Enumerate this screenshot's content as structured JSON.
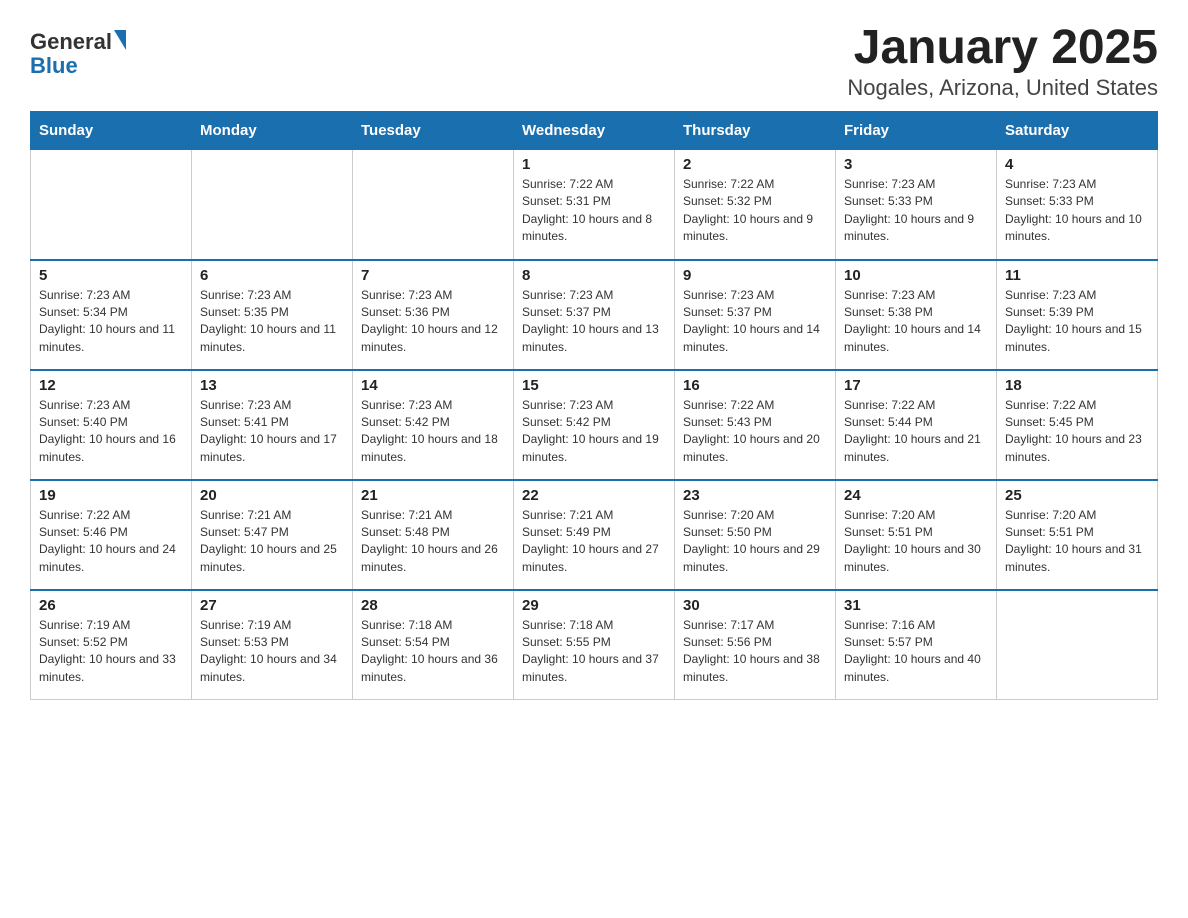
{
  "header": {
    "logo_general": "General",
    "logo_blue": "Blue",
    "month_title": "January 2025",
    "location": "Nogales, Arizona, United States"
  },
  "days_of_week": [
    "Sunday",
    "Monday",
    "Tuesday",
    "Wednesday",
    "Thursday",
    "Friday",
    "Saturday"
  ],
  "weeks": [
    [
      {
        "day": "",
        "info": ""
      },
      {
        "day": "",
        "info": ""
      },
      {
        "day": "",
        "info": ""
      },
      {
        "day": "1",
        "info": "Sunrise: 7:22 AM\nSunset: 5:31 PM\nDaylight: 10 hours and 8 minutes."
      },
      {
        "day": "2",
        "info": "Sunrise: 7:22 AM\nSunset: 5:32 PM\nDaylight: 10 hours and 9 minutes."
      },
      {
        "day": "3",
        "info": "Sunrise: 7:23 AM\nSunset: 5:33 PM\nDaylight: 10 hours and 9 minutes."
      },
      {
        "day": "4",
        "info": "Sunrise: 7:23 AM\nSunset: 5:33 PM\nDaylight: 10 hours and 10 minutes."
      }
    ],
    [
      {
        "day": "5",
        "info": "Sunrise: 7:23 AM\nSunset: 5:34 PM\nDaylight: 10 hours and 11 minutes."
      },
      {
        "day": "6",
        "info": "Sunrise: 7:23 AM\nSunset: 5:35 PM\nDaylight: 10 hours and 11 minutes."
      },
      {
        "day": "7",
        "info": "Sunrise: 7:23 AM\nSunset: 5:36 PM\nDaylight: 10 hours and 12 minutes."
      },
      {
        "day": "8",
        "info": "Sunrise: 7:23 AM\nSunset: 5:37 PM\nDaylight: 10 hours and 13 minutes."
      },
      {
        "day": "9",
        "info": "Sunrise: 7:23 AM\nSunset: 5:37 PM\nDaylight: 10 hours and 14 minutes."
      },
      {
        "day": "10",
        "info": "Sunrise: 7:23 AM\nSunset: 5:38 PM\nDaylight: 10 hours and 14 minutes."
      },
      {
        "day": "11",
        "info": "Sunrise: 7:23 AM\nSunset: 5:39 PM\nDaylight: 10 hours and 15 minutes."
      }
    ],
    [
      {
        "day": "12",
        "info": "Sunrise: 7:23 AM\nSunset: 5:40 PM\nDaylight: 10 hours and 16 minutes."
      },
      {
        "day": "13",
        "info": "Sunrise: 7:23 AM\nSunset: 5:41 PM\nDaylight: 10 hours and 17 minutes."
      },
      {
        "day": "14",
        "info": "Sunrise: 7:23 AM\nSunset: 5:42 PM\nDaylight: 10 hours and 18 minutes."
      },
      {
        "day": "15",
        "info": "Sunrise: 7:23 AM\nSunset: 5:42 PM\nDaylight: 10 hours and 19 minutes."
      },
      {
        "day": "16",
        "info": "Sunrise: 7:22 AM\nSunset: 5:43 PM\nDaylight: 10 hours and 20 minutes."
      },
      {
        "day": "17",
        "info": "Sunrise: 7:22 AM\nSunset: 5:44 PM\nDaylight: 10 hours and 21 minutes."
      },
      {
        "day": "18",
        "info": "Sunrise: 7:22 AM\nSunset: 5:45 PM\nDaylight: 10 hours and 23 minutes."
      }
    ],
    [
      {
        "day": "19",
        "info": "Sunrise: 7:22 AM\nSunset: 5:46 PM\nDaylight: 10 hours and 24 minutes."
      },
      {
        "day": "20",
        "info": "Sunrise: 7:21 AM\nSunset: 5:47 PM\nDaylight: 10 hours and 25 minutes."
      },
      {
        "day": "21",
        "info": "Sunrise: 7:21 AM\nSunset: 5:48 PM\nDaylight: 10 hours and 26 minutes."
      },
      {
        "day": "22",
        "info": "Sunrise: 7:21 AM\nSunset: 5:49 PM\nDaylight: 10 hours and 27 minutes."
      },
      {
        "day": "23",
        "info": "Sunrise: 7:20 AM\nSunset: 5:50 PM\nDaylight: 10 hours and 29 minutes."
      },
      {
        "day": "24",
        "info": "Sunrise: 7:20 AM\nSunset: 5:51 PM\nDaylight: 10 hours and 30 minutes."
      },
      {
        "day": "25",
        "info": "Sunrise: 7:20 AM\nSunset: 5:51 PM\nDaylight: 10 hours and 31 minutes."
      }
    ],
    [
      {
        "day": "26",
        "info": "Sunrise: 7:19 AM\nSunset: 5:52 PM\nDaylight: 10 hours and 33 minutes."
      },
      {
        "day": "27",
        "info": "Sunrise: 7:19 AM\nSunset: 5:53 PM\nDaylight: 10 hours and 34 minutes."
      },
      {
        "day": "28",
        "info": "Sunrise: 7:18 AM\nSunset: 5:54 PM\nDaylight: 10 hours and 36 minutes."
      },
      {
        "day": "29",
        "info": "Sunrise: 7:18 AM\nSunset: 5:55 PM\nDaylight: 10 hours and 37 minutes."
      },
      {
        "day": "30",
        "info": "Sunrise: 7:17 AM\nSunset: 5:56 PM\nDaylight: 10 hours and 38 minutes."
      },
      {
        "day": "31",
        "info": "Sunrise: 7:16 AM\nSunset: 5:57 PM\nDaylight: 10 hours and 40 minutes."
      },
      {
        "day": "",
        "info": ""
      }
    ]
  ]
}
